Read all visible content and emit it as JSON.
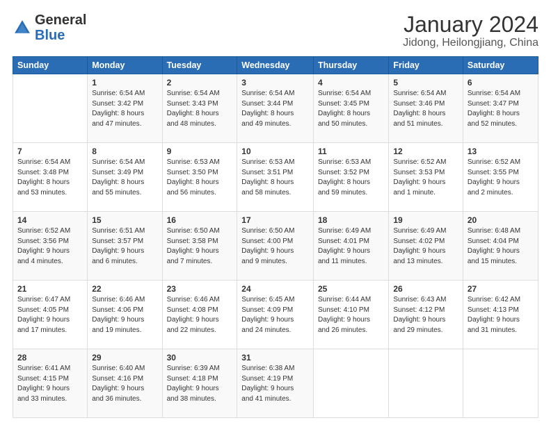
{
  "header": {
    "logo_general": "General",
    "logo_blue": "Blue",
    "title": "January 2024",
    "subtitle": "Jidong, Heilongjiang, China"
  },
  "days_of_week": [
    "Sunday",
    "Monday",
    "Tuesday",
    "Wednesday",
    "Thursday",
    "Friday",
    "Saturday"
  ],
  "weeks": [
    [
      {
        "day": "",
        "details": ""
      },
      {
        "day": "1",
        "details": "Sunrise: 6:54 AM\nSunset: 3:42 PM\nDaylight: 8 hours\nand 47 minutes."
      },
      {
        "day": "2",
        "details": "Sunrise: 6:54 AM\nSunset: 3:43 PM\nDaylight: 8 hours\nand 48 minutes."
      },
      {
        "day": "3",
        "details": "Sunrise: 6:54 AM\nSunset: 3:44 PM\nDaylight: 8 hours\nand 49 minutes."
      },
      {
        "day": "4",
        "details": "Sunrise: 6:54 AM\nSunset: 3:45 PM\nDaylight: 8 hours\nand 50 minutes."
      },
      {
        "day": "5",
        "details": "Sunrise: 6:54 AM\nSunset: 3:46 PM\nDaylight: 8 hours\nand 51 minutes."
      },
      {
        "day": "6",
        "details": "Sunrise: 6:54 AM\nSunset: 3:47 PM\nDaylight: 8 hours\nand 52 minutes."
      }
    ],
    [
      {
        "day": "7",
        "details": "Sunrise: 6:54 AM\nSunset: 3:48 PM\nDaylight: 8 hours\nand 53 minutes."
      },
      {
        "day": "8",
        "details": "Sunrise: 6:54 AM\nSunset: 3:49 PM\nDaylight: 8 hours\nand 55 minutes."
      },
      {
        "day": "9",
        "details": "Sunrise: 6:53 AM\nSunset: 3:50 PM\nDaylight: 8 hours\nand 56 minutes."
      },
      {
        "day": "10",
        "details": "Sunrise: 6:53 AM\nSunset: 3:51 PM\nDaylight: 8 hours\nand 58 minutes."
      },
      {
        "day": "11",
        "details": "Sunrise: 6:53 AM\nSunset: 3:52 PM\nDaylight: 8 hours\nand 59 minutes."
      },
      {
        "day": "12",
        "details": "Sunrise: 6:52 AM\nSunset: 3:53 PM\nDaylight: 9 hours\nand 1 minute."
      },
      {
        "day": "13",
        "details": "Sunrise: 6:52 AM\nSunset: 3:55 PM\nDaylight: 9 hours\nand 2 minutes."
      }
    ],
    [
      {
        "day": "14",
        "details": "Sunrise: 6:52 AM\nSunset: 3:56 PM\nDaylight: 9 hours\nand 4 minutes."
      },
      {
        "day": "15",
        "details": "Sunrise: 6:51 AM\nSunset: 3:57 PM\nDaylight: 9 hours\nand 6 minutes."
      },
      {
        "day": "16",
        "details": "Sunrise: 6:50 AM\nSunset: 3:58 PM\nDaylight: 9 hours\nand 7 minutes."
      },
      {
        "day": "17",
        "details": "Sunrise: 6:50 AM\nSunset: 4:00 PM\nDaylight: 9 hours\nand 9 minutes."
      },
      {
        "day": "18",
        "details": "Sunrise: 6:49 AM\nSunset: 4:01 PM\nDaylight: 9 hours\nand 11 minutes."
      },
      {
        "day": "19",
        "details": "Sunrise: 6:49 AM\nSunset: 4:02 PM\nDaylight: 9 hours\nand 13 minutes."
      },
      {
        "day": "20",
        "details": "Sunrise: 6:48 AM\nSunset: 4:04 PM\nDaylight: 9 hours\nand 15 minutes."
      }
    ],
    [
      {
        "day": "21",
        "details": "Sunrise: 6:47 AM\nSunset: 4:05 PM\nDaylight: 9 hours\nand 17 minutes."
      },
      {
        "day": "22",
        "details": "Sunrise: 6:46 AM\nSunset: 4:06 PM\nDaylight: 9 hours\nand 19 minutes."
      },
      {
        "day": "23",
        "details": "Sunrise: 6:46 AM\nSunset: 4:08 PM\nDaylight: 9 hours\nand 22 minutes."
      },
      {
        "day": "24",
        "details": "Sunrise: 6:45 AM\nSunset: 4:09 PM\nDaylight: 9 hours\nand 24 minutes."
      },
      {
        "day": "25",
        "details": "Sunrise: 6:44 AM\nSunset: 4:10 PM\nDaylight: 9 hours\nand 26 minutes."
      },
      {
        "day": "26",
        "details": "Sunrise: 6:43 AM\nSunset: 4:12 PM\nDaylight: 9 hours\nand 29 minutes."
      },
      {
        "day": "27",
        "details": "Sunrise: 6:42 AM\nSunset: 4:13 PM\nDaylight: 9 hours\nand 31 minutes."
      }
    ],
    [
      {
        "day": "28",
        "details": "Sunrise: 6:41 AM\nSunset: 4:15 PM\nDaylight: 9 hours\nand 33 minutes."
      },
      {
        "day": "29",
        "details": "Sunrise: 6:40 AM\nSunset: 4:16 PM\nDaylight: 9 hours\nand 36 minutes."
      },
      {
        "day": "30",
        "details": "Sunrise: 6:39 AM\nSunset: 4:18 PM\nDaylight: 9 hours\nand 38 minutes."
      },
      {
        "day": "31",
        "details": "Sunrise: 6:38 AM\nSunset: 4:19 PM\nDaylight: 9 hours\nand 41 minutes."
      },
      {
        "day": "",
        "details": ""
      },
      {
        "day": "",
        "details": ""
      },
      {
        "day": "",
        "details": ""
      }
    ]
  ]
}
